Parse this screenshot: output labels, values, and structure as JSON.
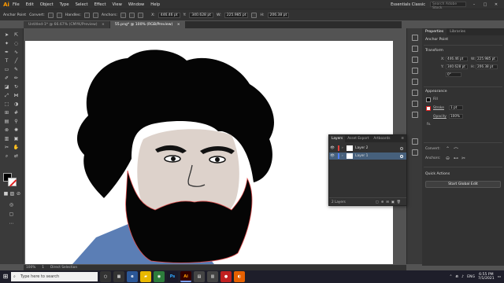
{
  "app": {
    "logo": "Ai"
  },
  "menu": [
    "File",
    "Edit",
    "Object",
    "Type",
    "Select",
    "Effect",
    "View",
    "Window",
    "Help"
  ],
  "workspace": {
    "label": "Essentials Classic",
    "search_placeholder": "Search Adobe Stock"
  },
  "control_bar": {
    "selection": "Anchor Point",
    "convert_label": "Convert:",
    "handles_label": "Handles:",
    "anchors_label": "Anchors:",
    "x": "446.46 pt",
    "y": "340.628 pt",
    "w": "225.985 pt",
    "h": "206.38 pt",
    "x_label": "X:",
    "y_label": "Y:",
    "w_label": "W:",
    "h_label": "H:"
  },
  "tabs": [
    {
      "label": "Untitled-1* @ 66.67% (CMYK/Preview)",
      "close": "×"
    },
    {
      "label": "55.png* @ 100% (RGB/Preview)",
      "close": "×"
    }
  ],
  "status": {
    "zoom": "100%",
    "page": "1",
    "tool": "Direct Selection"
  },
  "properties": {
    "tab_properties": "Properties",
    "tab_libraries": "Libraries",
    "selection": "Anchor Point",
    "transform_title": "Transform",
    "x": "446.46 pt",
    "y": "340.628 pt",
    "w": "225.985 pt",
    "h": "206.38 pt",
    "angle": "0°",
    "appearance_title": "Appearance",
    "fill_label": "Fill",
    "stroke_label": "Stroke",
    "stroke_value": "1 pt",
    "opacity_label": "Opacity",
    "opacity_value": "100%",
    "fx_label": "fx.",
    "convert_label": "Convert:",
    "anchors_label": "Anchors:",
    "quick_actions_title": "Quick Actions",
    "start_global_edit": "Start Global Edit"
  },
  "layers_panel": {
    "tab_layers": "Layers",
    "tab_asset_export": "Asset Export",
    "tab_artboards": "Artboards",
    "layers": [
      {
        "name": "Layer 2",
        "color": "#e0403a"
      },
      {
        "name": "Layer 1",
        "color": "#4f7fff"
      }
    ],
    "footer": "2 Layers"
  },
  "taskbar": {
    "search_placeholder": "Type here to search",
    "apps": [
      "Ps",
      "Ai"
    ],
    "lang": "ENG",
    "time": "6:55 PM",
    "date": "7/1/2021"
  }
}
